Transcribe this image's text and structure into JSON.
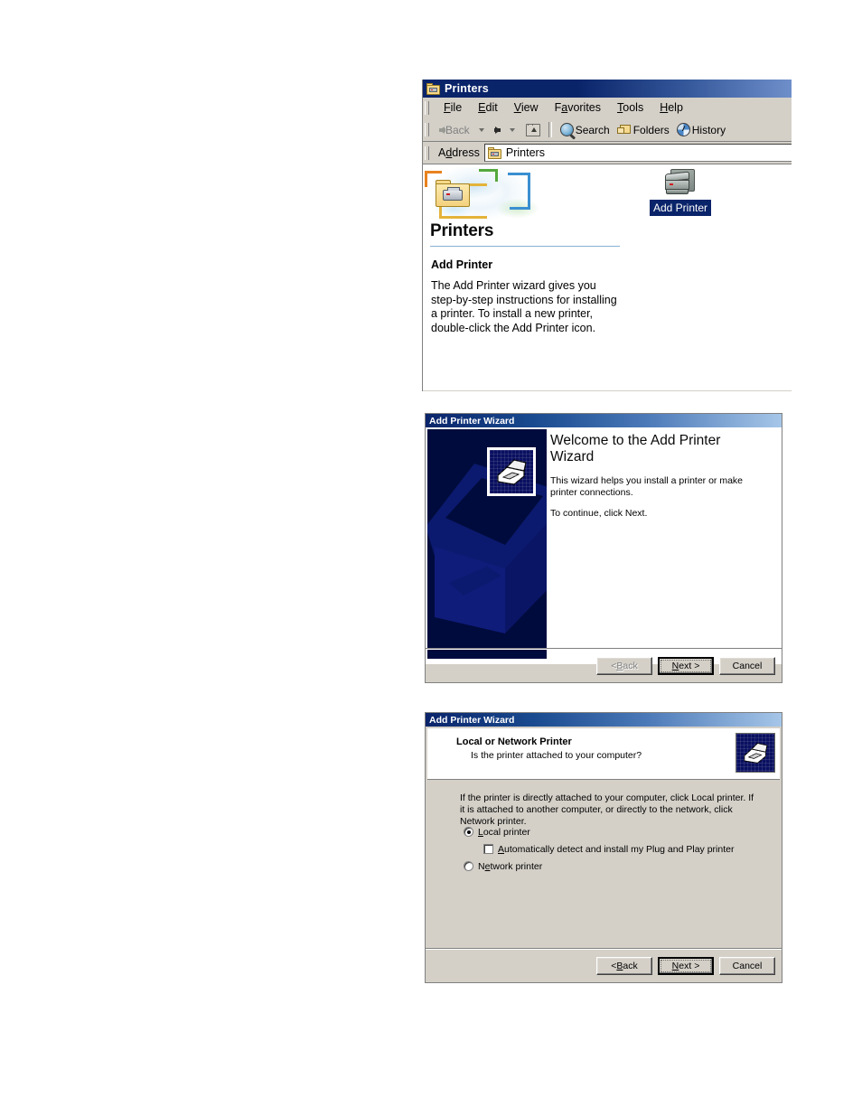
{
  "printers_window": {
    "title": "Printers",
    "title_icon": "folder-printer-icon",
    "menu": [
      {
        "pre": "",
        "key": "F",
        "post": "ile"
      },
      {
        "pre": "",
        "key": "E",
        "post": "dit"
      },
      {
        "pre": "",
        "key": "V",
        "post": "iew"
      },
      {
        "pre": "F",
        "key": "a",
        "post": "vorites"
      },
      {
        "pre": "",
        "key": "T",
        "post": "ools"
      },
      {
        "pre": "",
        "key": "H",
        "post": "elp"
      }
    ],
    "toolbar": {
      "back_label": "Back",
      "back_enabled": false,
      "forward_label": "",
      "up_label": "",
      "search_label": "Search",
      "folders_label": "Folders",
      "history_label": "History"
    },
    "address": {
      "label_pre": "A",
      "label_key": "d",
      "label_post": "dress",
      "value": "Printers",
      "icon": "folder-printer-icon"
    },
    "left_pane": {
      "heading": "Printers",
      "section_title": "Add Printer",
      "description": "The Add Printer wizard gives you step-by-step instructions for installing a printer. To install a new printer, double-click the Add Printer icon."
    },
    "items": [
      {
        "label": "Add Printer",
        "icon": "printer-icon",
        "selected": true
      }
    ]
  },
  "welcome_wizard": {
    "title": "Add Printer Wizard",
    "icon": "printer-wizard-icon",
    "heading": "Welcome to the Add Printer Wizard",
    "paragraph_1": "This wizard helps you install a printer or make printer connections.",
    "paragraph_2": "To continue, click Next.",
    "buttons": [
      {
        "name": "back",
        "pre": "< ",
        "key": "B",
        "post": "ack",
        "enabled": false,
        "default": false
      },
      {
        "name": "next",
        "pre": "",
        "key": "N",
        "post": "ext >",
        "enabled": true,
        "default": true
      },
      {
        "name": "cancel",
        "pre": "Cancel",
        "key": "",
        "post": "",
        "enabled": true,
        "default": false
      }
    ]
  },
  "local_network_wizard": {
    "title": "Add Printer Wizard",
    "icon": "printer-wizard-icon",
    "header_title": "Local or Network Printer",
    "header_subtitle": "Is the printer attached to your computer?",
    "intro": "If the printer is directly attached to your computer, click Local printer.  If it is attached to another computer, or directly to the network, click Network printer.",
    "options": [
      {
        "type": "radio",
        "name": "local-printer",
        "pre": "",
        "key": "L",
        "post": "ocal printer",
        "checked": true
      },
      {
        "type": "checkbox",
        "name": "autodetect-plug-and-play",
        "pre": "",
        "key": "A",
        "post": "utomatically detect and install my Plug and Play printer",
        "checked": false
      },
      {
        "type": "radio",
        "name": "network-printer",
        "pre": "N",
        "key": "e",
        "post": "twork printer",
        "checked": false
      }
    ],
    "buttons": [
      {
        "name": "back",
        "pre": "< ",
        "key": "B",
        "post": "ack",
        "enabled": true,
        "default": false
      },
      {
        "name": "next",
        "pre": "",
        "key": "N",
        "post": "ext >",
        "enabled": true,
        "default": true
      },
      {
        "name": "cancel",
        "pre": "Cancel",
        "key": "",
        "post": "",
        "enabled": true,
        "default": false
      }
    ]
  },
  "colors": {
    "title_navy": "#0a246a",
    "title_light_blue": "#a6c6e8",
    "window_face": "#d4d0c8",
    "selection_blue": "#0a246a",
    "wizard_watermark": "#000b3d",
    "accent_rule": "#8ab0d0"
  }
}
